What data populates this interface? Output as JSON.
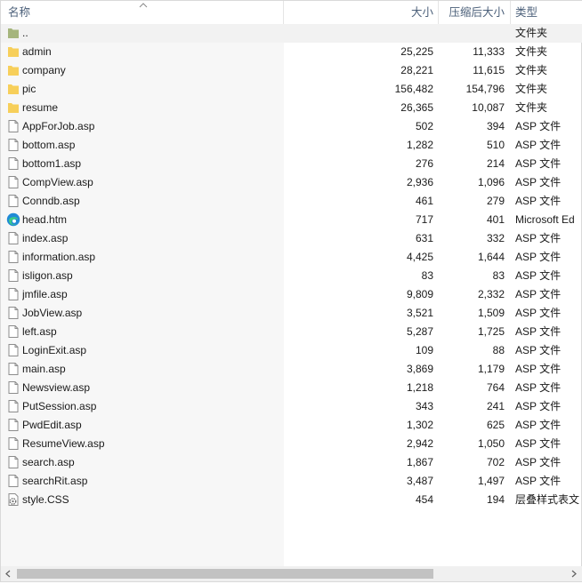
{
  "columns": {
    "name": "名称",
    "size": "大小",
    "compressed": "压缩后大小",
    "type": "类型"
  },
  "colors": {
    "folder": "#f7cf5a",
    "parent_folder": "#a5b57c",
    "header_text": "#4c607a",
    "name_column_bg": "#f7f7f7"
  },
  "rows": [
    {
      "icon": "parent-folder-icon",
      "name": "..",
      "size": "",
      "compressed": "",
      "type": "文件夹"
    },
    {
      "icon": "folder-icon",
      "name": "admin",
      "size": "25,225",
      "compressed": "11,333",
      "type": "文件夹"
    },
    {
      "icon": "folder-icon",
      "name": "company",
      "size": "28,221",
      "compressed": "11,615",
      "type": "文件夹"
    },
    {
      "icon": "folder-icon",
      "name": "pic",
      "size": "156,482",
      "compressed": "154,796",
      "type": "文件夹"
    },
    {
      "icon": "folder-icon",
      "name": "resume",
      "size": "26,365",
      "compressed": "10,087",
      "type": "文件夹"
    },
    {
      "icon": "file-icon",
      "name": "AppForJob.asp",
      "size": "502",
      "compressed": "394",
      "type": "ASP 文件"
    },
    {
      "icon": "file-icon",
      "name": "bottom.asp",
      "size": "1,282",
      "compressed": "510",
      "type": "ASP 文件"
    },
    {
      "icon": "file-icon",
      "name": "bottom1.asp",
      "size": "276",
      "compressed": "214",
      "type": "ASP 文件"
    },
    {
      "icon": "file-icon",
      "name": "CompView.asp",
      "size": "2,936",
      "compressed": "1,096",
      "type": "ASP 文件"
    },
    {
      "icon": "file-icon",
      "name": "Conndb.asp",
      "size": "461",
      "compressed": "279",
      "type": "ASP 文件"
    },
    {
      "icon": "edge-icon",
      "name": "head.htm",
      "size": "717",
      "compressed": "401",
      "type": "Microsoft Ed"
    },
    {
      "icon": "file-icon",
      "name": "index.asp",
      "size": "631",
      "compressed": "332",
      "type": "ASP 文件"
    },
    {
      "icon": "file-icon",
      "name": "information.asp",
      "size": "4,425",
      "compressed": "1,644",
      "type": "ASP 文件"
    },
    {
      "icon": "file-icon",
      "name": "isligon.asp",
      "size": "83",
      "compressed": "83",
      "type": "ASP 文件"
    },
    {
      "icon": "file-icon",
      "name": "jmfile.asp",
      "size": "9,809",
      "compressed": "2,332",
      "type": "ASP 文件"
    },
    {
      "icon": "file-icon",
      "name": "JobView.asp",
      "size": "3,521",
      "compressed": "1,509",
      "type": "ASP 文件"
    },
    {
      "icon": "file-icon",
      "name": "left.asp",
      "size": "5,287",
      "compressed": "1,725",
      "type": "ASP 文件"
    },
    {
      "icon": "file-icon",
      "name": "LoginExit.asp",
      "size": "109",
      "compressed": "88",
      "type": "ASP 文件"
    },
    {
      "icon": "file-icon",
      "name": "main.asp",
      "size": "3,869",
      "compressed": "1,179",
      "type": "ASP 文件"
    },
    {
      "icon": "file-icon",
      "name": "Newsview.asp",
      "size": "1,218",
      "compressed": "764",
      "type": "ASP 文件"
    },
    {
      "icon": "file-icon",
      "name": "PutSession.asp",
      "size": "343",
      "compressed": "241",
      "type": "ASP 文件"
    },
    {
      "icon": "file-icon",
      "name": "PwdEdit.asp",
      "size": "1,302",
      "compressed": "625",
      "type": "ASP 文件"
    },
    {
      "icon": "file-icon",
      "name": "ResumeView.asp",
      "size": "2,942",
      "compressed": "1,050",
      "type": "ASP 文件"
    },
    {
      "icon": "file-icon",
      "name": "search.asp",
      "size": "1,867",
      "compressed": "702",
      "type": "ASP 文件"
    },
    {
      "icon": "file-icon",
      "name": "searchRit.asp",
      "size": "3,487",
      "compressed": "1,497",
      "type": "ASP 文件"
    },
    {
      "icon": "css-file-icon",
      "name": "style.CSS",
      "size": "454",
      "compressed": "194",
      "type": "层叠样式表文"
    }
  ],
  "scrollbar": {
    "left_arrow": "‹",
    "right_arrow": "›"
  }
}
